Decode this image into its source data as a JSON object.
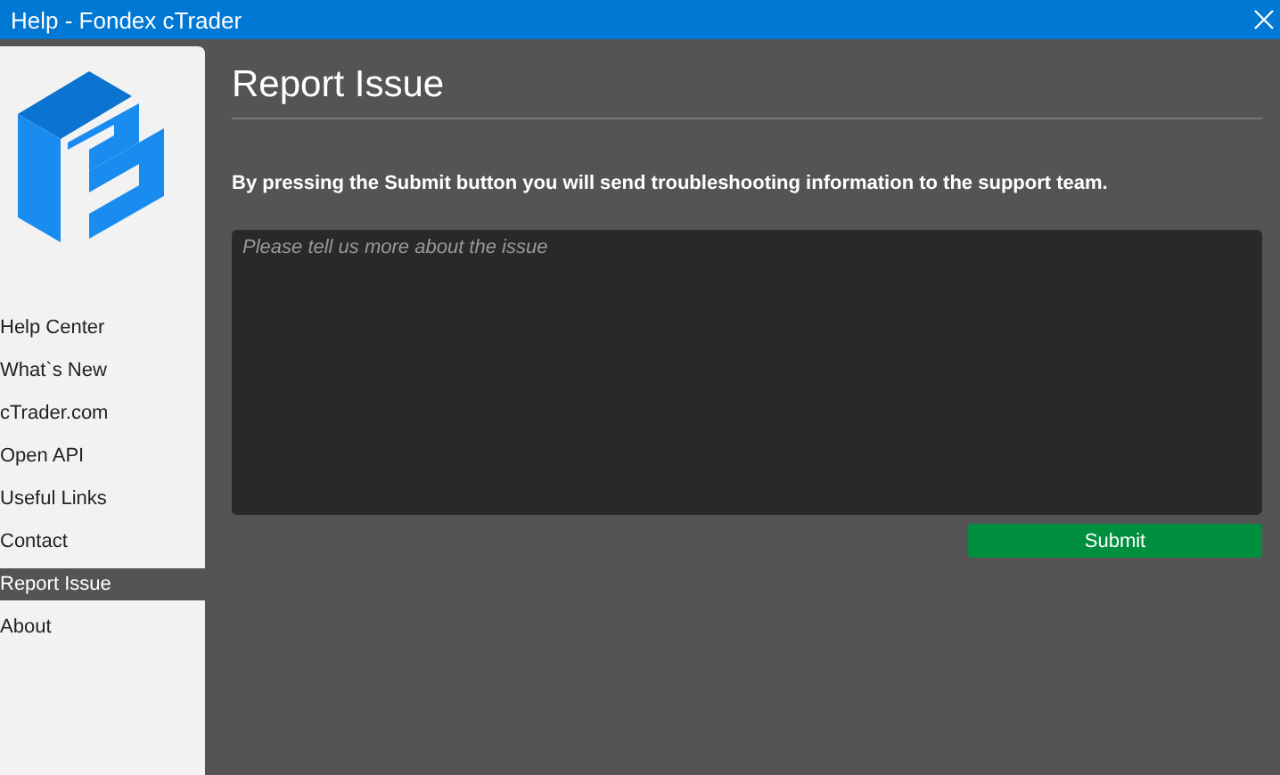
{
  "window": {
    "title": "Help - Fondex cTrader"
  },
  "sidebar": {
    "items": [
      {
        "label": "Help Center",
        "selected": false
      },
      {
        "label": "What`s New",
        "selected": false
      },
      {
        "label": "cTrader.com",
        "selected": false
      },
      {
        "label": "Open API",
        "selected": false
      },
      {
        "label": "Useful Links",
        "selected": false
      },
      {
        "label": "Contact",
        "selected": false
      },
      {
        "label": "Report Issue",
        "selected": true
      },
      {
        "label": "About",
        "selected": false
      }
    ]
  },
  "main": {
    "heading": "Report Issue",
    "notice": "By pressing the Submit button you will send troubleshooting information to the support team.",
    "issue_field": {
      "placeholder": "Please tell us more about the issue"
    },
    "submit_button": "Submit"
  }
}
